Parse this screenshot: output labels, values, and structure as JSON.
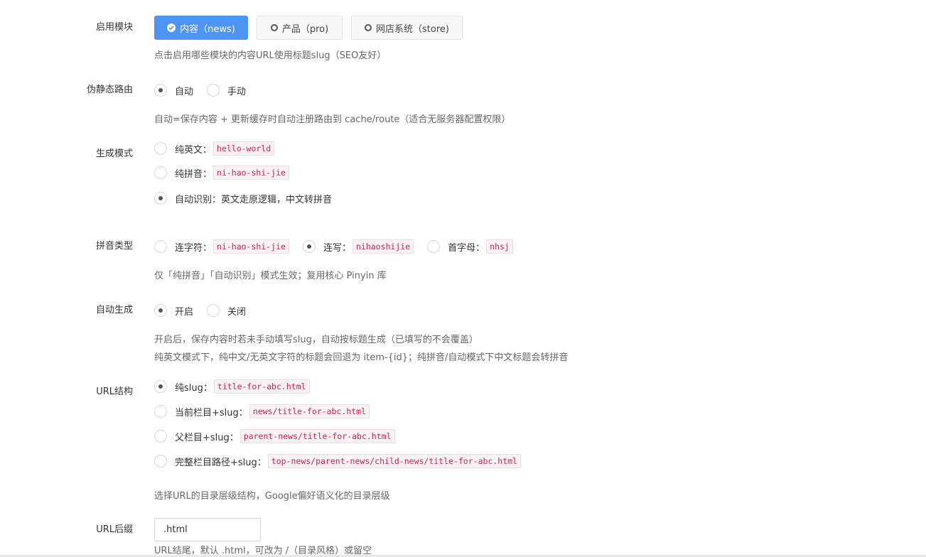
{
  "modules": {
    "label": "启用模块",
    "options": [
      {
        "label": "内容（news)",
        "active": true
      },
      {
        "label": "产品（pro)",
        "active": false
      },
      {
        "label": "网店系统（store)",
        "active": false
      }
    ],
    "help": "点击启用哪些模块的内容URL使用标题slug（SEO友好）"
  },
  "route": {
    "label": "伪静态路由",
    "options": [
      {
        "label": "自动",
        "checked": true
      },
      {
        "label": "手动",
        "checked": false
      }
    ],
    "help": "自动=保存内容 + 更新缓存时自动注册路由到 cache/route（适合无服务器配置权限）"
  },
  "gen_mode": {
    "label": "生成模式",
    "options": [
      {
        "label": "纯英文：",
        "code": "hello-world",
        "checked": false
      },
      {
        "label": "纯拼音：",
        "code": "ni-hao-shi-jie",
        "checked": false
      },
      {
        "label": "自动识别：英文走原逻辑，中文转拼音",
        "code": "",
        "checked": true
      }
    ]
  },
  "pinyin": {
    "label": "拼音类型",
    "options": [
      {
        "label": "连字符：",
        "code": "ni-hao-shi-jie",
        "checked": false
      },
      {
        "label": "连写：",
        "code": "nihaoshijie",
        "checked": true
      },
      {
        "label": "首字母：",
        "code": "nhsj",
        "checked": false
      }
    ],
    "help": "仅「纯拼音」「自动识别」模式生效；复用核心 Pinyin 库"
  },
  "auto_gen": {
    "label": "自动生成",
    "options": [
      {
        "label": "开启",
        "checked": true
      },
      {
        "label": "关闭",
        "checked": false
      }
    ],
    "help1": "开启后，保存内容时若未手动填写slug，自动按标题生成（已填写的不会覆盖）",
    "help2": "纯英文模式下，纯中文/无英文字符的标题会回退为 item-{id}；纯拼音/自动模式下中文标题会转拼音"
  },
  "url_struct": {
    "label": "URL结构",
    "options": [
      {
        "label": "纯slug：",
        "code": "title-for-abc.html",
        "checked": true
      },
      {
        "label": "当前栏目+slug：",
        "code": "news/title-for-abc.html",
        "checked": false
      },
      {
        "label": "父栏目+slug：",
        "code": "parent-news/title-for-abc.html",
        "checked": false
      },
      {
        "label": "完整栏目路径+slug：",
        "code": "top-news/parent-news/child-news/title-for-abc.html",
        "checked": false
      }
    ],
    "help": "选择URL的目录层级结构，Google偏好语义化的目录层级"
  },
  "suffix": {
    "label": "URL后缀",
    "value": ".html",
    "help": "URL结尾，默认 .html，可改为 /（目录风格）或留空"
  },
  "colors": {
    "accent": "#4d94f7",
    "code_text": "#c7254e",
    "code_bg": "#f9f2f4"
  }
}
